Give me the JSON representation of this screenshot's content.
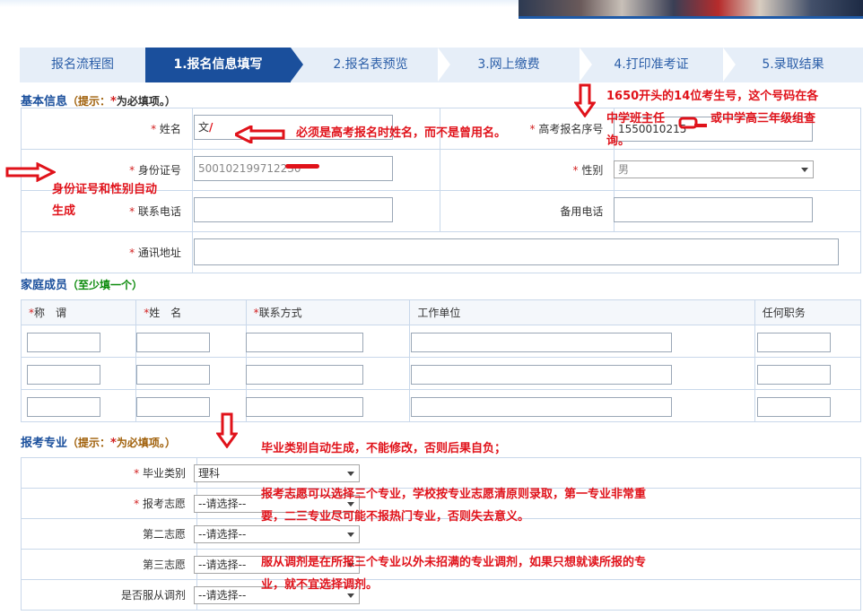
{
  "steps": [
    {
      "label": "报名流程图",
      "active": false
    },
    {
      "label": "1.报名信息填写",
      "active": true
    },
    {
      "label": "2.报名表预览",
      "active": false
    },
    {
      "label": "3.网上缴费",
      "active": false
    },
    {
      "label": "4.打印准考证",
      "active": false
    },
    {
      "label": "5.录取结果",
      "active": false
    }
  ],
  "basic": {
    "title": "基本信息",
    "hint_open": "（",
    "hint_label": "提示：",
    "hint_star": "*",
    "hint_text": "为必填项。）",
    "name_label": "姓名",
    "name_value": "文",
    "exam_no_label": "高考报名序号",
    "exam_no_value": "1550010215",
    "id_label": "身份证号",
    "id_value": "500102199712230",
    "gender_label": "性别",
    "gender_value": "男",
    "phone_label": "联系电话",
    "phone_value": "",
    "backup_phone_label": "备用电话",
    "backup_phone_value": "",
    "address_label": "通讯地址",
    "address_value": ""
  },
  "family": {
    "title": "家庭成员",
    "hint": "（至少填一个）",
    "headers": [
      "称　谓",
      "姓　名",
      "联系方式",
      "工作单位",
      "任何职务"
    ],
    "required": [
      true,
      true,
      true,
      false,
      false
    ],
    "rows": [
      [
        "",
        "",
        "",
        "",
        ""
      ],
      [
        "",
        "",
        "",
        "",
        ""
      ],
      [
        "",
        "",
        "",
        "",
        ""
      ]
    ]
  },
  "major": {
    "title": "报考专业",
    "hint_open": "（",
    "hint_label": "提示：",
    "hint_star": "*",
    "hint_text": "为必填项。）",
    "grad_type_label": "毕业类别",
    "grad_type_value": "理科",
    "choice1_label": "报考志愿",
    "choice1_value": "--请选择--",
    "choice2_label": "第二志愿",
    "choice2_value": "--请选择--",
    "choice3_label": "第三志愿",
    "choice3_value": "--请选择--",
    "adjust_label": "是否服从调剂",
    "adjust_value": "--请选择--"
  },
  "annotations": {
    "name_note": "必须是高考报名时姓名，而不是曾用名。",
    "exam_no_note_1": "1650开头的14位考生号，这个号码在各",
    "exam_no_note_2a": "中学班主任",
    "exam_no_note_2b": "或中学高三年级组查",
    "exam_no_note_3": "询。",
    "id_note_1": "身份证号和性别自动",
    "id_note_2": "生成",
    "grad_note": "毕业类别自动生成，不能修改，否则后果自负；",
    "choice_note_1": "报考志愿可以选择三个专业，学校按专业志愿清原则录取，第一专业非常重",
    "choice_note_2": "要，二三专业尽可能不报热门专业，否则失去意义。",
    "adjust_note_1": "服从调剂是在所报三个专业以外未招满的专业调剂，如果只想就读所报的专",
    "adjust_note_2": "业，就不宜选择调剂。"
  },
  "colors": {
    "accent": "#1a4f9c",
    "annotation": "#e0121a",
    "required": "#d21f1f"
  }
}
